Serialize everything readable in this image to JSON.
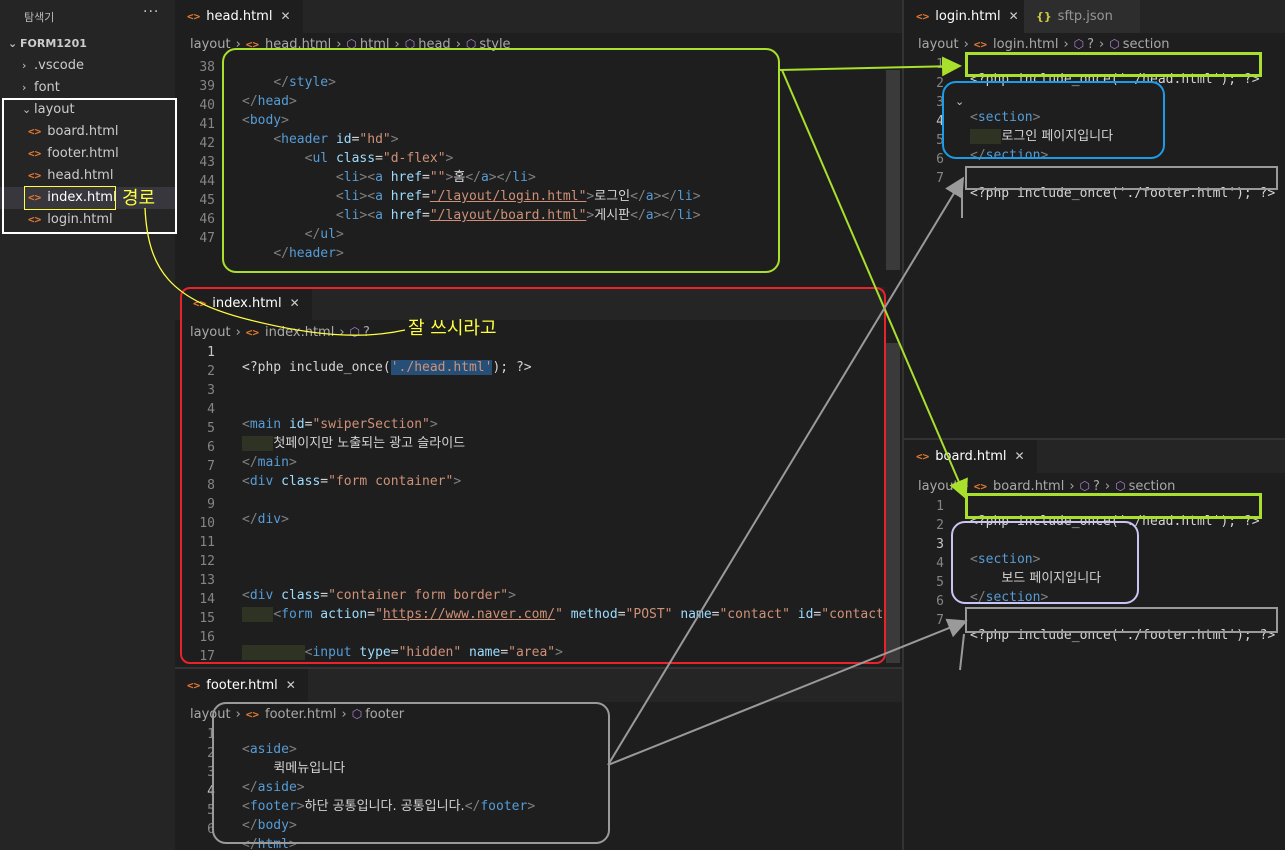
{
  "explorer": {
    "title": "탐색기",
    "more": "···",
    "project": "FORM1201",
    "folders": [
      ".vscode",
      "font",
      "layout"
    ],
    "layout_files": [
      "board.html",
      "footer.html",
      "head.html",
      "index.html",
      "login.html"
    ]
  },
  "icons": {
    "file_icon": "<>",
    "json_icon": "{}",
    "chevron_right": "›",
    "chevron_down": "⌄",
    "close": "✕",
    "bracket_icon": "⬡"
  },
  "head_editor": {
    "tab": "head.html",
    "breadcrumb": [
      "layout",
      "head.html",
      "html",
      "head",
      "style"
    ],
    "lines": [
      "38",
      "39",
      "40",
      "41",
      "42",
      "43",
      "44",
      "45",
      "46",
      "47"
    ]
  },
  "index_editor": {
    "tab": "index.html",
    "breadcrumb": [
      "layout",
      "index.html",
      "?"
    ],
    "lines": [
      "1",
      "2",
      "3",
      "4",
      "5",
      "6",
      "7",
      "8",
      "9",
      "10",
      "11",
      "12",
      "13",
      "14",
      "15",
      "16",
      "17"
    ],
    "ad_text": "첫페이지만 노출되는 광고 슬라이드"
  },
  "footer_editor": {
    "tab": "footer.html",
    "breadcrumb": [
      "layout",
      "footer.html",
      "footer"
    ],
    "lines": [
      "1",
      "2",
      "3",
      "4",
      "5",
      "6"
    ],
    "quick_text": "퀵메뉴입니다",
    "footer_text": "하단 공통입니다. 공통입니다."
  },
  "login_editor": {
    "tab": "login.html",
    "tab2": "sftp.json",
    "breadcrumb": [
      "layout",
      "login.html",
      "?",
      "section"
    ],
    "lines": [
      "1",
      "2",
      "3",
      "4",
      "5",
      "6",
      "7"
    ],
    "page_text": "로그인 페이지입니다"
  },
  "board_editor": {
    "tab": "board.html",
    "breadcrumb": [
      "layout",
      "board.html",
      "?",
      "section"
    ],
    "lines": [
      "1",
      "2",
      "3",
      "4",
      "5",
      "6",
      "7"
    ],
    "page_text": "보드 페이지입니다"
  },
  "annotations": {
    "path_label": "경로",
    "use_label": "잘 쓰시라고"
  },
  "colors": {
    "green": "#a8e02c",
    "red": "#e8242a",
    "blue": "#1e9be6",
    "gray": "#9a9a9a",
    "lavender": "#c8c4f4",
    "yellow": "#ffff40"
  }
}
